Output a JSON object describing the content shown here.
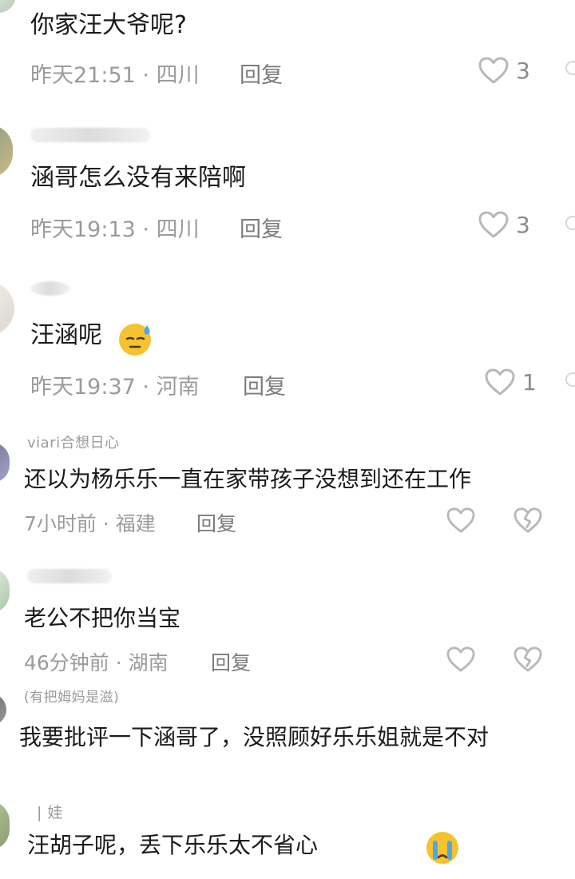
{
  "comments": [
    {
      "text": "你家汪大爷呢?",
      "time": "昨天21:51",
      "location": "四川",
      "reply_label": "回复",
      "likes": "3"
    },
    {
      "text": "涵哥怎么没有来陪啊",
      "time": "昨天19:13",
      "location": "四川",
      "reply_label": "回复",
      "likes": "3"
    },
    {
      "text": "汪涵呢",
      "time": "昨天19:37",
      "location": "河南",
      "reply_label": "回复",
      "likes": "1",
      "emoji": "sweat-emoji"
    },
    {
      "username": "viari合想日心",
      "text": "还以为杨乐乐一直在家带孩子没想到还在工作",
      "time": "7小时前",
      "location": "福建",
      "reply_label": "回复"
    },
    {
      "text": "老公不把你当宝",
      "time": "46分钟前",
      "location": "湖南",
      "reply_label": "回复"
    },
    {
      "username": "(有把姆妈是滋)",
      "text": "我要批评一下涵哥了，没照顾好乐乐姐就是不对"
    },
    {
      "username": "| 娃",
      "text": "汪胡子呢，丢下乐乐太不省心",
      "emoji": "crying-emoji"
    }
  ],
  "theme": {
    "meta_color": "#9b9b9b",
    "text_color": "#1b1b1b",
    "heart_color": "#b8b8b8"
  }
}
